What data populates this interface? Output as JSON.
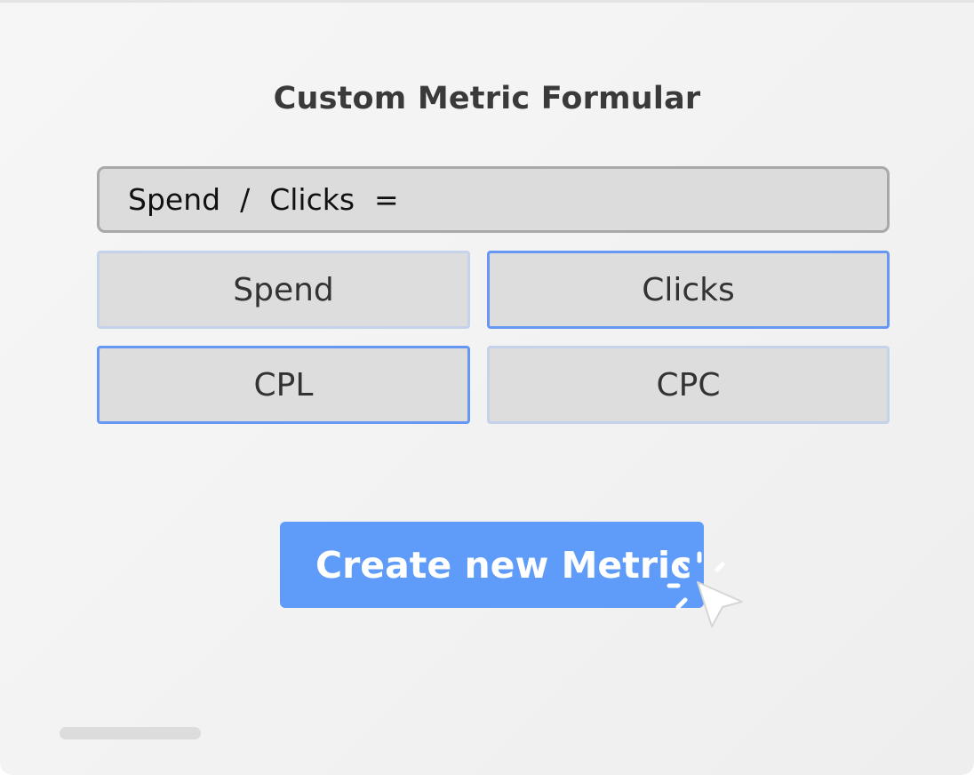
{
  "title": "Custom Metric Formular",
  "formula": {
    "operand1": "Spend",
    "operator": "/",
    "operand2": "Clicks",
    "equals": "="
  },
  "metric_options": [
    {
      "label": "Spend",
      "highlighted": false
    },
    {
      "label": "Clicks",
      "highlighted": true
    },
    {
      "label": "CPL",
      "highlighted": true
    },
    {
      "label": "CPC",
      "highlighted": false
    }
  ],
  "create_button": {
    "label": "Create new Metric"
  },
  "colors": {
    "accent": "#5f9bf9",
    "highlight_border": "#6698f3",
    "light_border": "#c4d2ea",
    "tile_bg": "#dddddd"
  },
  "icons": {
    "cursor": "click-cursor-icon"
  }
}
